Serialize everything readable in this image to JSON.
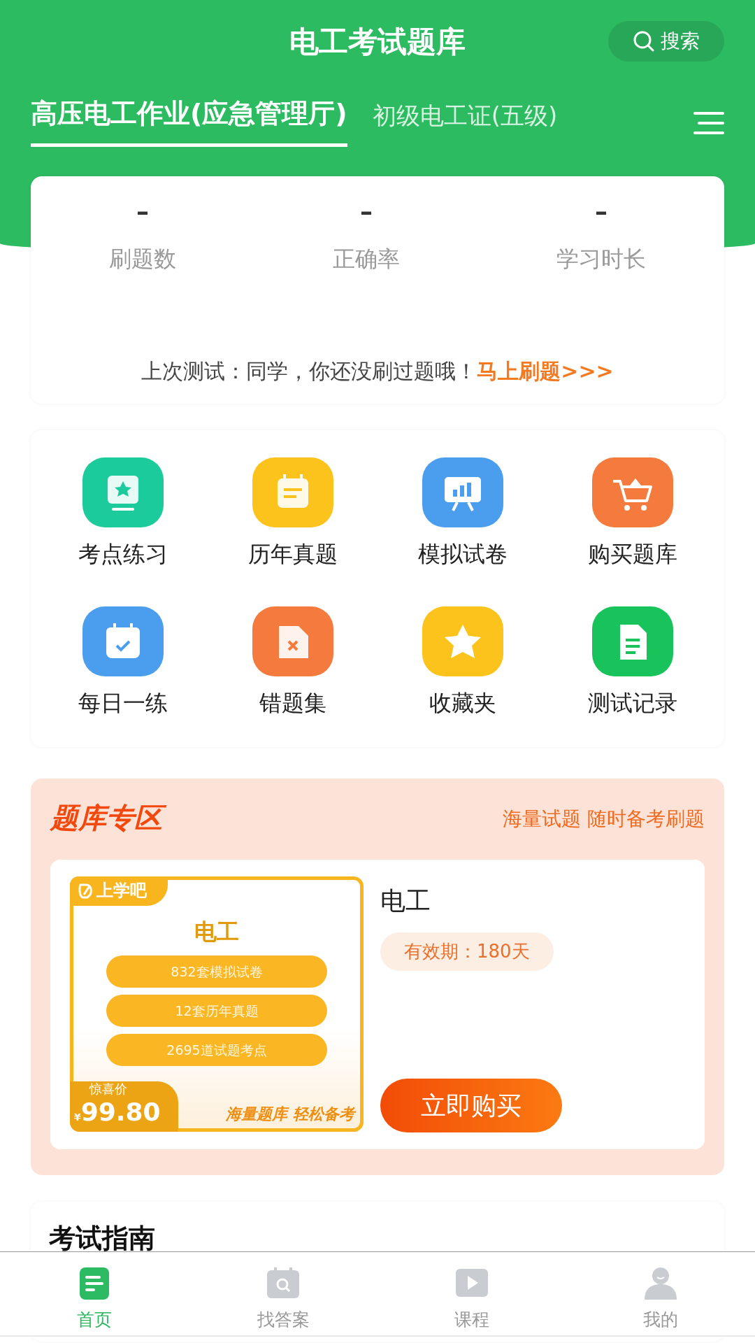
{
  "header": {
    "title": "电工考试题库",
    "search": "搜索"
  },
  "tabs": [
    {
      "label": "高压电工作业(应急管理厅)",
      "selected": true
    },
    {
      "label": "初级电工证(五级)",
      "selected": false
    }
  ],
  "stats": [
    {
      "value": "–",
      "label": "刷题数"
    },
    {
      "value": "–",
      "label": "正确率"
    },
    {
      "value": "–",
      "label": "学习时长"
    }
  ],
  "last_test": {
    "text": "上次测试：同学，你还没刷过题哦！",
    "link": "马上刷题>>>"
  },
  "features": [
    {
      "label": "考点练习",
      "color": "#1ccb9c"
    },
    {
      "label": "历年真题",
      "color": "#fcc31c"
    },
    {
      "label": "模拟试卷",
      "color": "#4b9ded"
    },
    {
      "label": "购买题库",
      "color": "#f47a3e"
    },
    {
      "label": "每日一练",
      "color": "#4b9ded"
    },
    {
      "label": "错题集",
      "color": "#f47a3e"
    },
    {
      "label": "收藏夹",
      "color": "#fcc31c"
    },
    {
      "label": "测试记录",
      "color": "#17c35a"
    }
  ],
  "zone": {
    "title": "题库专区",
    "slogan": "海量试题 随时备考刷题",
    "product": {
      "brand": "上学吧",
      "subject": "电工",
      "items": [
        "832套模拟试卷",
        "12套历年真题",
        "2695道试题考点"
      ],
      "price_label": "惊喜价",
      "currency": "¥",
      "price": "99.80",
      "tagline": "海量题库 轻松备考",
      "name": "电工",
      "validity": "有效期：180天",
      "buy": "立即购买"
    }
  },
  "guide": {
    "title": "考试指南"
  },
  "nav": [
    {
      "label": "首页",
      "selected": true
    },
    {
      "label": "找答案",
      "selected": false
    },
    {
      "label": "课程",
      "selected": false
    },
    {
      "label": "我的",
      "selected": false
    }
  ]
}
